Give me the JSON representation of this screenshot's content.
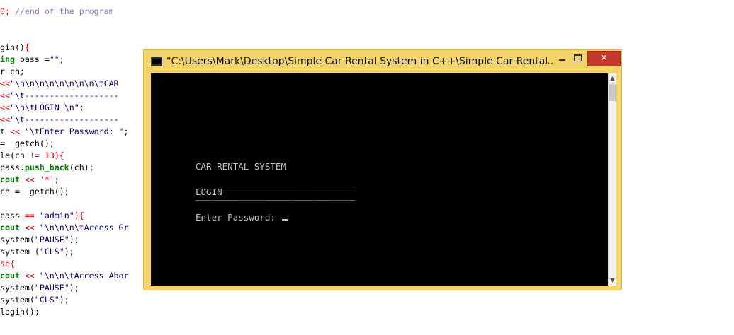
{
  "editor": {
    "lines": [
      [
        {
          "t": "0;",
          "c": "num"
        },
        {
          "t": " //end of the program",
          "c": "comment"
        }
      ],
      [],
      [],
      [
        {
          "t": "gin()",
          "c": "plain"
        },
        {
          "t": "{",
          "c": "op"
        }
      ],
      [
        {
          "t": "ing",
          "c": "kw"
        },
        {
          "t": " pass =",
          "c": "plain"
        },
        {
          "t": "\"\"",
          "c": "str"
        },
        {
          "t": ";",
          "c": "plain"
        }
      ],
      [
        {
          "t": "r ch;",
          "c": "plain"
        }
      ],
      [
        {
          "t": "<<",
          "c": "op"
        },
        {
          "t": "\"\\n\\n\\n\\n\\n\\n\\n\\n\\tCAR",
          "c": "str"
        }
      ],
      [
        {
          "t": "<<",
          "c": "op"
        },
        {
          "t": "\"\\t-------------------",
          "c": "str"
        }
      ],
      [
        {
          "t": "<<",
          "c": "op"
        },
        {
          "t": "\"\\n\\tLOGIN \\n\"",
          "c": "str"
        },
        {
          "t": ";",
          "c": "plain"
        }
      ],
      [
        {
          "t": "<<",
          "c": "op"
        },
        {
          "t": "\"\\t-------------------",
          "c": "str"
        }
      ],
      [
        {
          "t": "t ",
          "c": "plain"
        },
        {
          "t": "<<",
          "c": "op"
        },
        {
          "t": " \"\\tEnter Password: \"",
          "c": "str"
        },
        {
          "t": ";",
          "c": "plain"
        }
      ],
      [
        {
          "t": "= _getch();",
          "c": "plain"
        }
      ],
      [
        {
          "t": "le(ch ",
          "c": "plain"
        },
        {
          "t": "!=",
          "c": "op"
        },
        {
          "t": " 13",
          "c": "num"
        },
        {
          "t": "){",
          "c": "op"
        }
      ],
      [
        {
          "t": "pass.",
          "c": "plain"
        },
        {
          "t": "push_back",
          "c": "fn"
        },
        {
          "t": "(ch);",
          "c": "plain"
        }
      ],
      [
        {
          "t": "cout",
          "c": "kw"
        },
        {
          "t": " << ",
          "c": "op"
        },
        {
          "t": "'*'",
          "c": "num"
        },
        {
          "t": ";",
          "c": "plain"
        }
      ],
      [
        {
          "t": "ch = _getch();",
          "c": "plain"
        }
      ],
      [],
      [
        {
          "t": "pass ",
          "c": "plain"
        },
        {
          "t": "==",
          "c": "op"
        },
        {
          "t": " \"admin\"",
          "c": "str"
        },
        {
          "t": "){",
          "c": "op"
        }
      ],
      [
        {
          "t": "cout",
          "c": "kw"
        },
        {
          "t": " << ",
          "c": "op"
        },
        {
          "t": "\"\\n\\n\\n\\tAccess Gr",
          "c": "str"
        }
      ],
      [
        {
          "t": "system(",
          "c": "plain"
        },
        {
          "t": "\"PAUSE\"",
          "c": "str"
        },
        {
          "t": ");",
          "c": "plain"
        }
      ],
      [
        {
          "t": "system (",
          "c": "plain"
        },
        {
          "t": "\"CLS\"",
          "c": "str"
        },
        {
          "t": ");",
          "c": "plain"
        }
      ],
      [
        {
          "t": "se{",
          "c": "op"
        }
      ],
      [
        {
          "t": "cout",
          "c": "kw"
        },
        {
          "t": " << ",
          "c": "op"
        },
        {
          "t": "\"\\n\\n\\tAccess Abor",
          "c": "str"
        }
      ],
      [
        {
          "t": "system(",
          "c": "plain"
        },
        {
          "t": "\"PAUSE\"",
          "c": "str"
        },
        {
          "t": ");",
          "c": "plain"
        }
      ],
      [
        {
          "t": "system(",
          "c": "plain"
        },
        {
          "t": "\"CLS\"",
          "c": "str"
        },
        {
          "t": ");",
          "c": "plain"
        }
      ],
      [
        {
          "t": "login();",
          "c": "plain"
        }
      ]
    ]
  },
  "console": {
    "title": "\"C:\\Users\\Mark\\Desktop\\Simple Car Rental System in C++\\Simple Car Rental Sy",
    "title_ellipsis": "...",
    "close_label": "✕",
    "output": {
      "heading": "CAR RENTAL SYSTEM",
      "rule_top": "______________________________",
      "login": "LOGIN",
      "rule_bottom": "______________________________",
      "prompt": "Enter Password: "
    },
    "scroll_up": "▲",
    "scroll_down": "▼"
  },
  "colors": {
    "window_frame": "#f2d46a",
    "close_button": "#c7392e",
    "console_bg": "#000000",
    "console_text": "#c0c0c0"
  }
}
